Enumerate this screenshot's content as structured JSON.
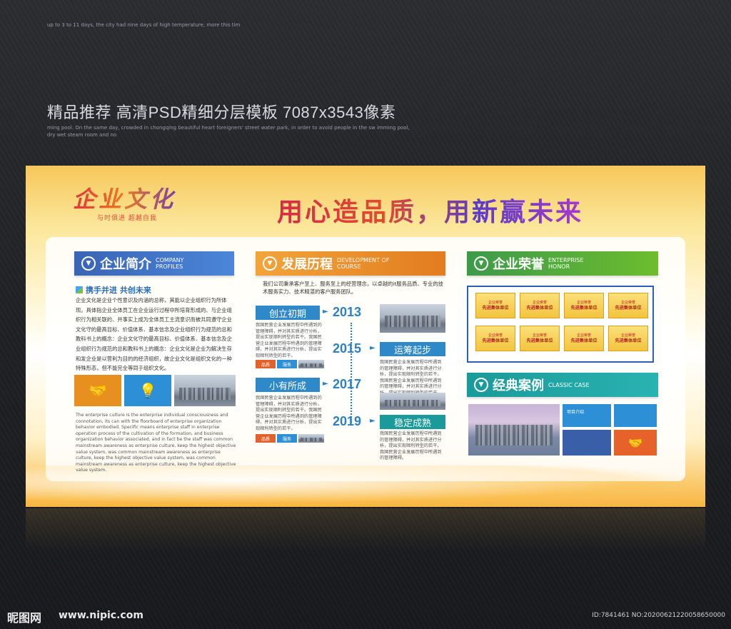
{
  "header": {
    "tiny_text": "up to 3 to 11 days, the city had nine days of high temperature, more this tim",
    "title": "精品推荐 高清PSD精细分层模板 7087x3543像素",
    "small_text": "ming pool. On the same day, crowded in chongqing beautiful heart foreigners' street water park, in order to avoid people in the sw imming pool, dry wet steam room and no"
  },
  "board": {
    "logo": "企业文化",
    "logo_sub": "与时俱进 超越自我",
    "slogan": "用心造品质，用新赢未来",
    "profile": {
      "title_cn": "企业简介",
      "title_en": "COMPANY PROFILES",
      "subtitle": "携手并进 共创未来",
      "body": "企业文化是企业个性意识及内涵的总称，其能以企业组织行为所体现。具体指企业全体员工在企业运行过程中所培育形成的、与企业组织行为相关联的、并事实上成为全体员工主流意识而被共同遵守企业文化守的最高目标、价值体系、基本信念及企业组织行为规范的总和教科书上的概念：企业文化守的最高目标、价值体系、基本信念及企业组织行为规范的总和教科书上的概念：企业文化是企业为解决生存和发企业是以营利为目的的经济组织，故企业文化是组织文化的一种特殊形态，但不能完全等同于组织文化。",
      "en_body": "The enterprise culture is the enterprise individual consciousness and connotation, its can with the floorboard of enterprise organization behavior embodied. Specific means enterprise staff in enterprise operation process of the cultivation of the formation, and business organization behavior associated, and in fact be the staff was common mainstream awareness as enterprise culture, keep the highest objective value system, was common mainstream awareness as enterprise culture, keep the highest objective value system, was common mainstream awareness as enterprise culture, keep the highest objective value system."
    },
    "history": {
      "title_cn": "发展历程",
      "title_en": "DEVELOPMENT OF COURSE",
      "intro": "我们公司秉承客户至上、服务至上的经营理念，以卓越的it服务品质、专业的技术服务实力、技术精湛的客户服务团队。",
      "events": [
        {
          "tag": "创立初期",
          "year": "2013",
          "text": "我国民营企业发展历程中所遇到的管理障碍，并对其实质进行分析，提出实现顺利转型的若干。我国民营企业发展历程中所遇到的管理障碍，并对其实质进行分析，提出实现顺利转型的若干。"
        },
        {
          "tag": "运筹起步",
          "year": "2015",
          "text": "我国民营企业发展历程中所遇到的管理障碍，并对其实质进行分析，提出实现顺利转型的若干。我国民营企业发展历程中所遇到的管理障碍，并对其实质进行分析，提出实现顺利转型的若干。"
        },
        {
          "tag": "小有所成",
          "year": "2017",
          "text": "我国民营企业发展历程中所遇到的管理障碍，并对其实质进行分析，提出实现顺利转型的若干。我国民营企业发展历程中所遇到的管理障碍，并对其实质进行分析，提出实现顺利转型的若干。"
        },
        {
          "tag": "稳定成熟",
          "year": "2019",
          "text": "我国民营企业发展历程中所遇到的管理障碍，并对其实质进行分析，提出实现顺利转型的若干。我国民营企业发展历程中所遇到的管理障碍。"
        }
      ],
      "mini_a": "品质",
      "mini_b": "服务"
    },
    "honor": {
      "title_cn": "企业荣誉",
      "title_en": "ENTERPRISE HONOR",
      "cert_top": "企业荣誉",
      "cert_main": "先进集体单位"
    },
    "cases": {
      "title_cn": "经典案例",
      "title_en": "CLASSIC CASE",
      "box_label": "项目介绍"
    }
  },
  "footer": {
    "logo": "昵图网",
    "url": "www.nipic.com",
    "id": "ID:7841461 NO:20200621220058650000"
  },
  "colors": {
    "blue": "#3a64b6",
    "orange": "#e27c1f",
    "green": "#4fa83c",
    "teal": "#1a9a9a"
  }
}
